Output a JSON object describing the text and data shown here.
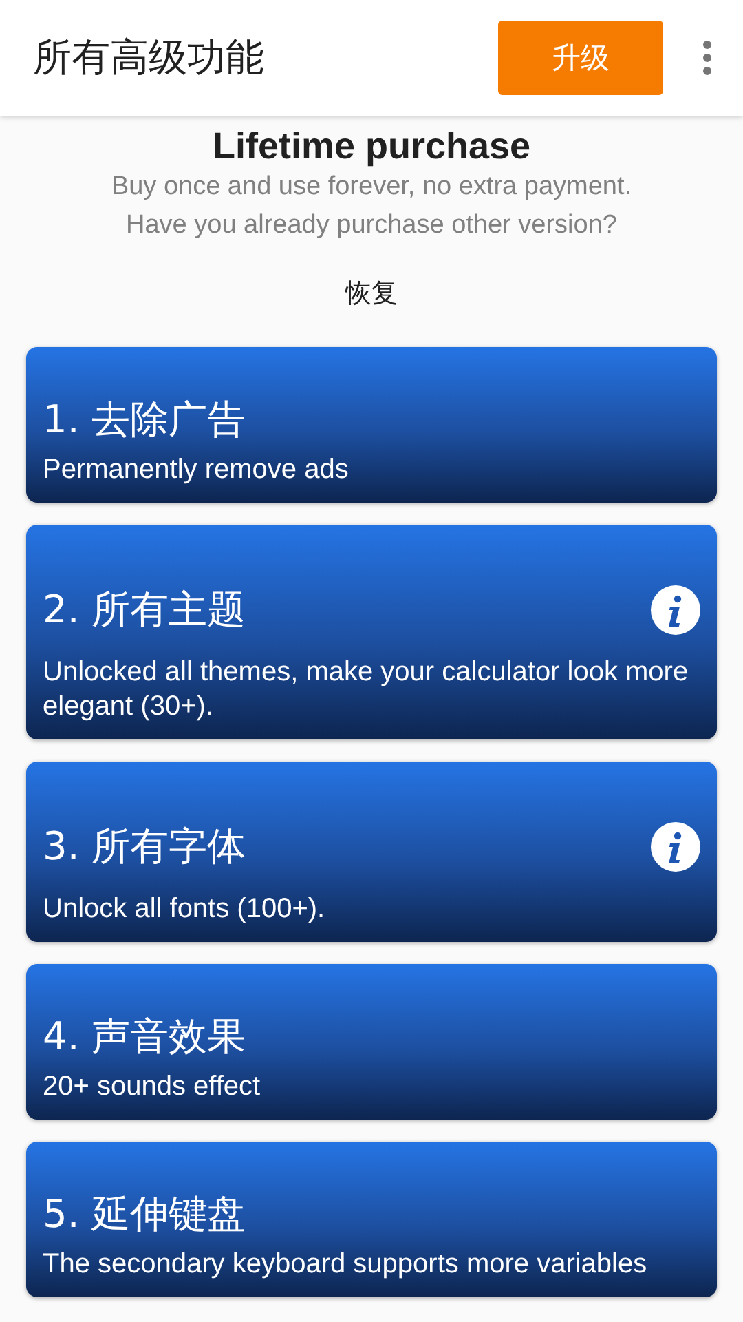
{
  "app_bar": {
    "title": "所有高级功能",
    "upgrade_button": "升级",
    "has_menu": true
  },
  "intro": {
    "title": "Lifetime purchase",
    "lines": [
      "Buy once and use forever, no extra payment.",
      "Have you already purchase other version?"
    ],
    "restore_link": "恢复"
  },
  "features": [
    {
      "title": "1. 去除广告",
      "description": "Permanently remove ads",
      "info": false
    },
    {
      "title": "2. 所有主题",
      "description": "Unlocked all themes, make your calculator look more elegant (30+).",
      "info": true
    },
    {
      "title": "3. 所有字体",
      "description": "Unlock all fonts (100+).",
      "info": true
    },
    {
      "title": "4. 声音效果",
      "description": "20+ sounds effect",
      "info": false
    },
    {
      "title": "5. 延伸键盘",
      "description": "The secondary keyboard supports more variables",
      "info": false
    }
  ]
}
